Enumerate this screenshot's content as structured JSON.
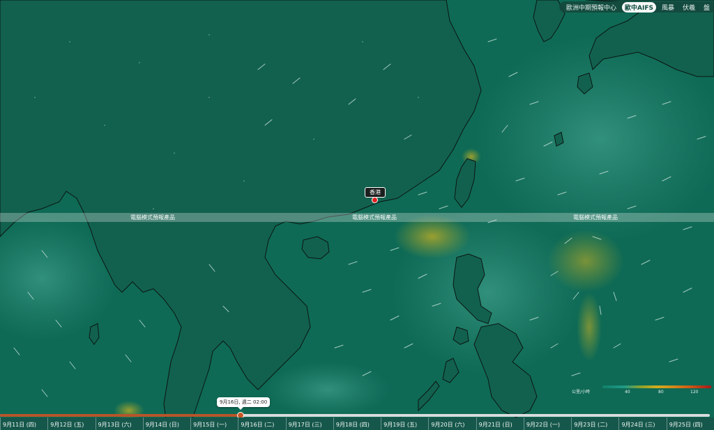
{
  "tabs": [
    {
      "label": "歐洲中期預報中心",
      "active": false
    },
    {
      "label": "歐中AIFS",
      "active": true
    },
    {
      "label": "風暴",
      "active": false
    },
    {
      "label": "伏羲",
      "active": false
    },
    {
      "label": "盤",
      "active": false
    }
  ],
  "band_label": "電腦模式預報產品",
  "location": {
    "label": "香港"
  },
  "legend": {
    "unit": "公里/小時",
    "ticks": [
      "40",
      "80",
      "120"
    ]
  },
  "timeline": {
    "tooltip": "9月16日, 週二 02:00",
    "progress": 0.338,
    "days": [
      "9月11日 (四)",
      "9月12日 (五)",
      "9月13日 (六)",
      "9月14日 (日)",
      "9月15日 (一)",
      "9月16日 (二)",
      "9月17日 (三)",
      "9月18日 (四)",
      "9月19日 (五)",
      "9月20日 (六)",
      "9月21日 (日)",
      "9月22日 (一)",
      "9月23日 (二)",
      "9月24日 (三)",
      "9月25日 (四)"
    ]
  },
  "colors": {
    "sea": "#0e6a55",
    "land": "#12614f",
    "high_wind": "#9aa232",
    "track_fill": "#b8552a"
  }
}
